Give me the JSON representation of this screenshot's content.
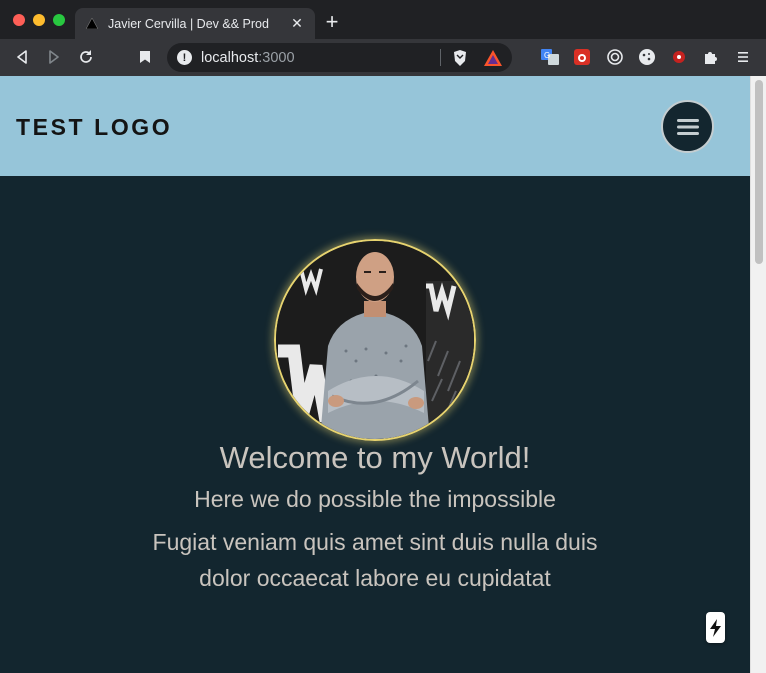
{
  "browser": {
    "tab": {
      "title": "Javier Cervilla | Dev && Prod",
      "favicon": "triangle-favicon-icon"
    },
    "address": {
      "host": "localhost",
      "port": ":3000"
    },
    "extensions": [
      "translate-icon",
      "bug-icon",
      "target-icon",
      "cookie-icon",
      "record-icon",
      "puzzle-icon",
      "menu-icon"
    ]
  },
  "page": {
    "logo": "TEST LOGO",
    "hero": {
      "title": "Welcome to my World!",
      "subtitle": "Here we do possible the impossible",
      "body": "Fugiat veniam quis amet sint duis nulla duis dolor occaecat labore eu cupidatat"
    },
    "colors": {
      "header_bg": "#96c5d9",
      "page_bg": "#13262f",
      "text": "#c9c4be",
      "avatar_ring": "#e7d36f"
    }
  }
}
